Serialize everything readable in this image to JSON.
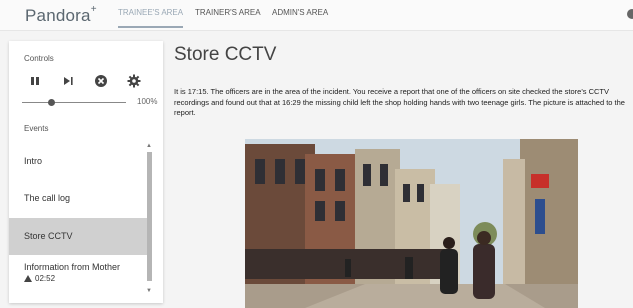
{
  "app": {
    "logo": "Pandora",
    "logo_mark": "+",
    "nav": [
      {
        "label": "TRAINEE'S AREA",
        "active": true
      },
      {
        "label": "TRAINER'S AREA",
        "active": false
      },
      {
        "label": "ADMIN'S AREA",
        "active": false
      }
    ]
  },
  "sidebar": {
    "controls_label": "Controls",
    "controls": [
      {
        "name": "pause-icon",
        "glyph": "❚❚"
      },
      {
        "name": "skip-next-icon",
        "glyph": "▶❘"
      },
      {
        "name": "stop-icon",
        "glyph": "✕"
      },
      {
        "name": "gear-icon",
        "glyph": "⚙"
      }
    ],
    "slider": {
      "value_fraction": 0.28,
      "display": "100%"
    },
    "events_label": "Events",
    "events": [
      {
        "label": "Intro",
        "active": false
      },
      {
        "label": "The call log",
        "active": false
      },
      {
        "label": "Store CCTV",
        "active": true
      },
      {
        "label": "Information from Mother",
        "active": false,
        "time": "02:52"
      }
    ]
  },
  "main": {
    "title": "Store CCTV",
    "text": "It is 17:15. The officers are in the area of the incident. You receive a report that one of the officers on site checked the store's CCTV recordings and found out that at 16:29 the missing child left the shop holding hands with two teenage girls. The picture is attached to the report."
  },
  "colors": {
    "accent": "#9aa8b5",
    "active_event_bg": "#d0d0d0"
  }
}
